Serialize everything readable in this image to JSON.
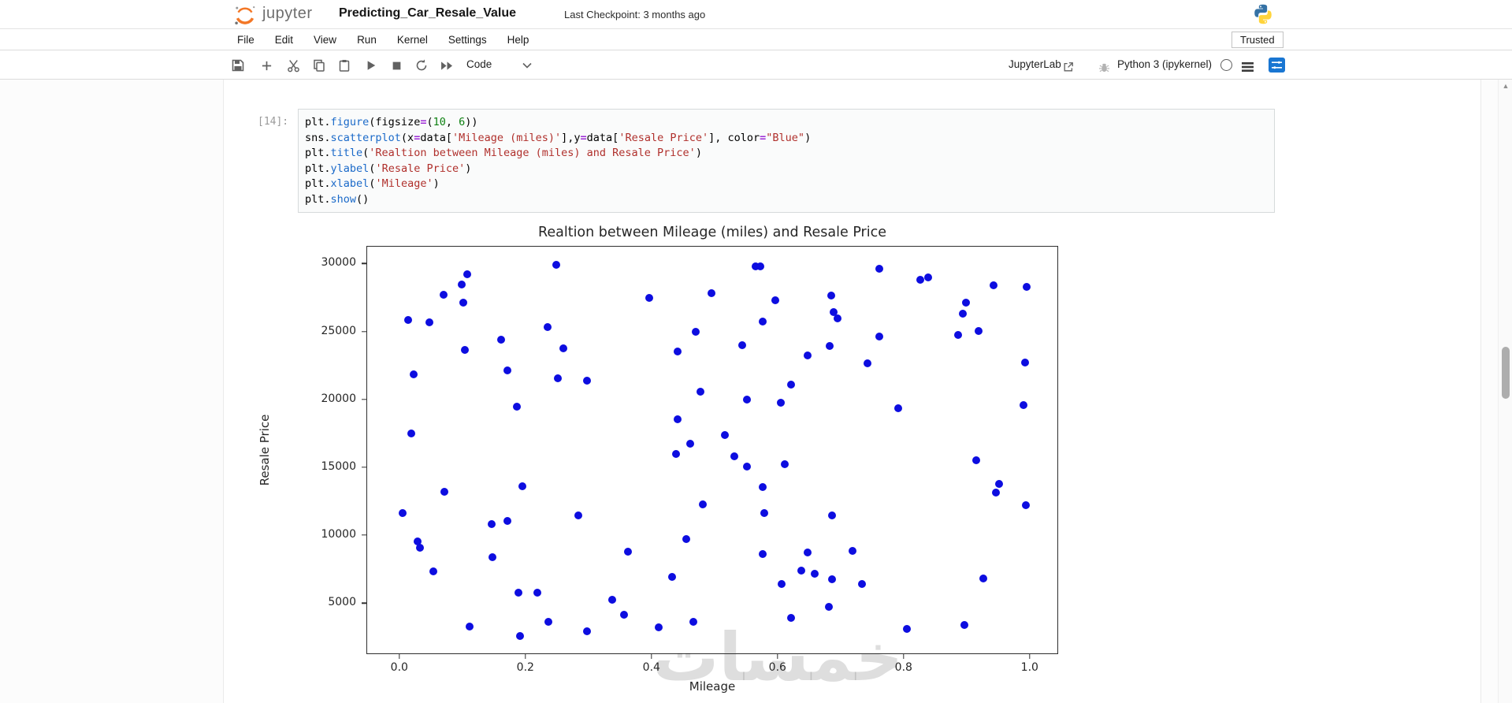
{
  "header": {
    "wordmark": "jupyter",
    "title": "Predicting_Car_Resale_Value",
    "checkpoint": "Last Checkpoint: 3 months ago"
  },
  "menu": {
    "items": [
      "File",
      "Edit",
      "View",
      "Run",
      "Kernel",
      "Settings",
      "Help"
    ],
    "trusted_label": "Trusted"
  },
  "toolbar": {
    "cell_type_label": "Code",
    "jupyterlab_label": "JupyterLab",
    "kernel_name_label": "Python 3 (ipykernel)"
  },
  "cell": {
    "prompt": "[14]:",
    "code_lines": [
      [
        [
          "d",
          "plt."
        ],
        [
          "f",
          "figure"
        ],
        [
          "d",
          "(figsize"
        ],
        [
          "o",
          "="
        ],
        [
          "d",
          "("
        ],
        [
          "n",
          "10"
        ],
        [
          "d",
          ", "
        ],
        [
          "n",
          "6"
        ],
        [
          "d",
          "))"
        ]
      ],
      [
        [
          "d",
          "sns."
        ],
        [
          "f",
          "scatterplot"
        ],
        [
          "d",
          "(x"
        ],
        [
          "o",
          "="
        ],
        [
          "d",
          "data["
        ],
        [
          "s",
          "'Mileage (miles)'"
        ],
        [
          "d",
          "],y"
        ],
        [
          "o",
          "="
        ],
        [
          "d",
          "data["
        ],
        [
          "s",
          "'Resale Price'"
        ],
        [
          "d",
          "], color"
        ],
        [
          "o",
          "="
        ],
        [
          "s",
          "\"Blue\""
        ],
        [
          "d",
          ")"
        ]
      ],
      [
        [
          "d",
          "plt."
        ],
        [
          "f",
          "title"
        ],
        [
          "d",
          "("
        ],
        [
          "s",
          "'Realtion between Mileage (miles) and Resale Price'"
        ],
        [
          "d",
          ")"
        ]
      ],
      [
        [
          "d",
          "plt."
        ],
        [
          "f",
          "ylabel"
        ],
        [
          "d",
          "("
        ],
        [
          "s",
          "'Resale Price'"
        ],
        [
          "d",
          ")"
        ]
      ],
      [
        [
          "d",
          "plt."
        ],
        [
          "f",
          "xlabel"
        ],
        [
          "d",
          "("
        ],
        [
          "s",
          "'Mileage'"
        ],
        [
          "d",
          ")"
        ]
      ],
      [
        [
          "d",
          "plt."
        ],
        [
          "f",
          "show"
        ],
        [
          "d",
          "()"
        ]
      ]
    ]
  },
  "chart_data": {
    "type": "scatter",
    "title": "Realtion between Mileage (miles) and Resale Price",
    "xlabel": "Mileage",
    "ylabel": "Resale Price",
    "marker_color": "#0d0de0",
    "grid": false,
    "xlim": [
      -0.051,
      1.044
    ],
    "ylim": [
      1300,
      31240
    ],
    "x_ticks": [
      {
        "v": 0.0,
        "label": "0.0"
      },
      {
        "v": 0.2,
        "label": "0.2"
      },
      {
        "v": 0.4,
        "label": "0.4"
      },
      {
        "v": 0.6,
        "label": "0.6"
      },
      {
        "v": 0.8,
        "label": "0.8"
      },
      {
        "v": 1.0,
        "label": "1.0"
      }
    ],
    "y_ticks": [
      {
        "v": 5000,
        "label": "5000"
      },
      {
        "v": 10000,
        "label": "10000"
      },
      {
        "v": 15000,
        "label": "15000"
      },
      {
        "v": 20000,
        "label": "20000"
      },
      {
        "v": 25000,
        "label": "25000"
      },
      {
        "v": 30000,
        "label": "30000"
      }
    ],
    "points": [
      [
        0.014,
        25850
      ],
      [
        0.048,
        25650
      ],
      [
        0.07,
        27700
      ],
      [
        0.099,
        28450
      ],
      [
        0.108,
        29200
      ],
      [
        0.102,
        27100
      ],
      [
        0.023,
        21850
      ],
      [
        0.104,
        23650
      ],
      [
        0.161,
        24400
      ],
      [
        0.172,
        22150
      ],
      [
        0.186,
        19450
      ],
      [
        0.249,
        29900
      ],
      [
        0.235,
        25350
      ],
      [
        0.26,
        23750
      ],
      [
        0.252,
        21550
      ],
      [
        0.298,
        21400
      ],
      [
        0.019,
        17500
      ],
      [
        0.565,
        29800
      ],
      [
        0.573,
        29800
      ],
      [
        0.396,
        27450
      ],
      [
        0.495,
        27800
      ],
      [
        0.597,
        27300
      ],
      [
        0.577,
        25700
      ],
      [
        0.47,
        24950
      ],
      [
        0.544,
        24000
      ],
      [
        0.648,
        23250
      ],
      [
        0.441,
        23550
      ],
      [
        0.621,
        21100
      ],
      [
        0.478,
        20550
      ],
      [
        0.551,
        20000
      ],
      [
        0.605,
        19750
      ],
      [
        0.442,
        18550
      ],
      [
        0.516,
        17350
      ],
      [
        0.461,
        16750
      ],
      [
        0.762,
        29600
      ],
      [
        0.827,
        28800
      ],
      [
        0.839,
        28950
      ],
      [
        0.943,
        28400
      ],
      [
        0.995,
        28300
      ],
      [
        0.685,
        27650
      ],
      [
        0.689,
        26450
      ],
      [
        0.695,
        25950
      ],
      [
        0.899,
        27100
      ],
      [
        0.894,
        26300
      ],
      [
        0.919,
        25050
      ],
      [
        0.887,
        24750
      ],
      [
        0.762,
        24600
      ],
      [
        0.683,
        23950
      ],
      [
        0.743,
        22650
      ],
      [
        0.993,
        22700
      ],
      [
        0.792,
        19350
      ],
      [
        0.99,
        19600
      ],
      [
        0.005,
        11650
      ],
      [
        0.072,
        13200
      ],
      [
        0.029,
        9550
      ],
      [
        0.033,
        9100
      ],
      [
        0.054,
        7350
      ],
      [
        0.147,
        10800
      ],
      [
        0.172,
        11050
      ],
      [
        0.195,
        13600
      ],
      [
        0.148,
        8350
      ],
      [
        0.189,
        5750
      ],
      [
        0.219,
        5750
      ],
      [
        0.237,
        3600
      ],
      [
        0.111,
        3300
      ],
      [
        0.191,
        2550
      ],
      [
        0.284,
        11450
      ],
      [
        0.298,
        2900
      ],
      [
        0.439,
        16000
      ],
      [
        0.532,
        15800
      ],
      [
        0.551,
        15050
      ],
      [
        0.611,
        15200
      ],
      [
        0.577,
        13550
      ],
      [
        0.482,
        12250
      ],
      [
        0.579,
        11650
      ],
      [
        0.455,
        9700
      ],
      [
        0.363,
        8800
      ],
      [
        0.577,
        8600
      ],
      [
        0.648,
        8700
      ],
      [
        0.638,
        7400
      ],
      [
        0.659,
        7150
      ],
      [
        0.433,
        6900
      ],
      [
        0.606,
        6400
      ],
      [
        0.338,
        5250
      ],
      [
        0.357,
        4150
      ],
      [
        0.411,
        3200
      ],
      [
        0.466,
        3600
      ],
      [
        0.621,
        3900
      ],
      [
        0.915,
        15500
      ],
      [
        0.952,
        13750
      ],
      [
        0.946,
        13150
      ],
      [
        0.994,
        12200
      ],
      [
        0.687,
        11450
      ],
      [
        0.719,
        8850
      ],
      [
        0.686,
        6750
      ],
      [
        0.734,
        6400
      ],
      [
        0.926,
        6800
      ],
      [
        0.682,
        4700
      ],
      [
        0.805,
        3100
      ],
      [
        0.896,
        3400
      ]
    ]
  },
  "watermark_text": "خمسات"
}
